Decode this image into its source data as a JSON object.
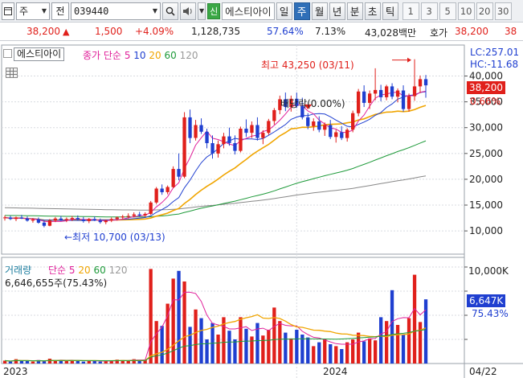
{
  "toolbar": {
    "market": "주",
    "mode": "전",
    "code": "039440",
    "badge": "신",
    "name": "에스티아이",
    "periods": [
      "일",
      "주",
      "월",
      "년",
      "분",
      "초",
      "틱"
    ],
    "active_period": "주",
    "counts": [
      "1",
      "3",
      "5",
      "10",
      "20",
      "30"
    ]
  },
  "quote": {
    "price": "38,200",
    "arrow": "▲",
    "change": "1,500",
    "pct": "+4.09%",
    "volume": "1,128,735",
    "vol_ratio": "57.64%",
    "turnover": "7.13%",
    "amount": "43,028백만",
    "ask_label": "호가",
    "ask_price": "38,200",
    "ask_price2": "38"
  },
  "panel": {
    "stock_label": "에스티아이",
    "ma_label": "종가 단순",
    "ma_periods": [
      "5",
      "10",
      "20",
      "60",
      "120"
    ],
    "high_annotation": "최고 43,250 (03/11)",
    "low_annotation": "←최저 10,700 (03/13)",
    "dividend_annotation": "배당락(0.00%)",
    "lc": "LC:257.01",
    "hc": "HC:-11.68",
    "last_price": "38,200",
    "last_pct": "0.66%",
    "vol_label": "거래량",
    "vol_ma_label": "단순",
    "vol_periods": [
      "5",
      "20",
      "60",
      "120"
    ],
    "vol_info": "6,646,655주(75.43%)",
    "vol_last": "6,647K",
    "vol_pct": "75.43%",
    "vol_max_tick": "10,000K",
    "x_labels": [
      "2023",
      "2024",
      "04/22"
    ]
  },
  "colors": {
    "up": "#e0201b",
    "down": "#1f3fd0",
    "ma5": "#e0209a",
    "ma10": "#1f3fd0",
    "ma20": "#f0a500",
    "ma60": "#1e9a3a",
    "ma120": "#888888"
  },
  "chart_data": {
    "type": "candlestick",
    "y_ticks": [
      10000,
      15000,
      20000,
      25000,
      30000,
      35000,
      40000
    ],
    "ylim": [
      5500,
      46000
    ],
    "volume_ylim": [
      0,
      10500
    ],
    "volume_ticks": [
      "10,000K"
    ],
    "last_price": 38200,
    "high": {
      "value": 43250,
      "date": "03/11"
    },
    "low": {
      "value": 10700,
      "date": "03/13"
    },
    "candles": [
      [
        12500,
        13000,
        12000,
        12600
      ],
      [
        12600,
        12900,
        12100,
        12300
      ],
      [
        12300,
        12800,
        11900,
        12600
      ],
      [
        12600,
        13100,
        12300,
        12400
      ],
      [
        12400,
        12800,
        11800,
        12000
      ],
      [
        12000,
        12500,
        11600,
        12200
      ],
      [
        12200,
        12600,
        11400,
        11600
      ],
      [
        11600,
        12000,
        10700,
        11000
      ],
      [
        11000,
        12300,
        10900,
        12000
      ],
      [
        12000,
        12700,
        11700,
        12400
      ],
      [
        12400,
        12900,
        11900,
        12100
      ],
      [
        12100,
        12600,
        11700,
        12300
      ],
      [
        12300,
        12900,
        11900,
        12500
      ],
      [
        12500,
        13000,
        12000,
        12200
      ],
      [
        12200,
        12700,
        11600,
        11900
      ],
      [
        11900,
        12500,
        11500,
        12300
      ],
      [
        12300,
        12800,
        11900,
        12000
      ],
      [
        12000,
        12400,
        11400,
        11700
      ],
      [
        11700,
        12200,
        11300,
        12000
      ],
      [
        12000,
        12600,
        11700,
        12300
      ],
      [
        12300,
        12800,
        12000,
        12600
      ],
      [
        12600,
        13100,
        12300,
        12800
      ],
      [
        12800,
        13400,
        12400,
        12900
      ],
      [
        12900,
        13600,
        12600,
        13200
      ],
      [
        13200,
        13700,
        12800,
        13000
      ],
      [
        13000,
        13600,
        12700,
        13300
      ],
      [
        13300,
        15800,
        13100,
        15500
      ],
      [
        15500,
        18500,
        15200,
        18200
      ],
      [
        18200,
        19000,
        17000,
        17500
      ],
      [
        17500,
        18800,
        17100,
        18500
      ],
      [
        18500,
        22500,
        18300,
        22000
      ],
      [
        22000,
        25000,
        19800,
        20500
      ],
      [
        20500,
        33000,
        20200,
        32000
      ],
      [
        32000,
        33500,
        27000,
        28000
      ],
      [
        28000,
        31500,
        27500,
        30500
      ],
      [
        30500,
        31800,
        28800,
        29200
      ],
      [
        29200,
        29800,
        26000,
        27000
      ],
      [
        27000,
        28500,
        24000,
        25000
      ],
      [
        25000,
        27500,
        24200,
        26800
      ],
      [
        26800,
        29000,
        26000,
        28300
      ],
      [
        28300,
        30000,
        26500,
        27000
      ],
      [
        27000,
        28500,
        24800,
        25500
      ],
      [
        25500,
        30200,
        25200,
        29800
      ],
      [
        29800,
        31600,
        28200,
        29000
      ],
      [
        29000,
        31200,
        28000,
        30500
      ],
      [
        30500,
        32000,
        27500,
        28000
      ],
      [
        28000,
        29500,
        26800,
        29000
      ],
      [
        29000,
        31700,
        28600,
        31300
      ],
      [
        31300,
        33800,
        30600,
        33400
      ],
      [
        33400,
        36200,
        32600,
        35500
      ],
      [
        35500,
        36800,
        33200,
        34000
      ],
      [
        34000,
        36200,
        33100,
        35600
      ],
      [
        35600,
        36800,
        33800,
        34200
      ],
      [
        34200,
        35800,
        31600,
        32000
      ],
      [
        32000,
        32800,
        29700,
        30300
      ],
      [
        30300,
        31800,
        29400,
        31200
      ],
      [
        31200,
        32200,
        29100,
        29600
      ],
      [
        29600,
        31000,
        28400,
        30500
      ],
      [
        30500,
        31500,
        27800,
        28200
      ],
      [
        28200,
        29600,
        27100,
        29100
      ],
      [
        29100,
        30300,
        27600,
        28000
      ],
      [
        28000,
        29900,
        27300,
        29600
      ],
      [
        29600,
        33300,
        29100,
        32800
      ],
      [
        32800,
        37500,
        32200,
        37000
      ],
      [
        37000,
        38200,
        34000,
        34800
      ],
      [
        34800,
        37200,
        33600,
        36600
      ],
      [
        36600,
        41500,
        35300,
        37300
      ],
      [
        37300,
        38300,
        35100,
        35900
      ],
      [
        35900,
        38300,
        35300,
        38000
      ],
      [
        38000,
        38600,
        35500,
        36000
      ],
      [
        36000,
        37600,
        34900,
        37200
      ],
      [
        37200,
        38200,
        33100,
        33600
      ],
      [
        33600,
        36600,
        33100,
        36100
      ],
      [
        36100,
        43250,
        35200,
        38000
      ],
      [
        38000,
        40100,
        36700,
        39400
      ],
      [
        39400,
        40200,
        35800,
        38200
      ]
    ],
    "volume_k": [
      300,
      200,
      450,
      250,
      300,
      200,
      350,
      250,
      500,
      300,
      350,
      250,
      300,
      350,
      200,
      300,
      250,
      200,
      300,
      250,
      400,
      350,
      300,
      450,
      350,
      400,
      9800,
      4400,
      3900,
      6200,
      8800,
      9600,
      8500,
      3800,
      5600,
      4700,
      2500,
      4200,
      3000,
      4800,
      3400,
      2500,
      4800,
      3600,
      2800,
      4200,
      2900,
      3500,
      5800,
      4400,
      3200,
      2600,
      3500,
      3000,
      2700,
      1800,
      2200,
      2500,
      2000,
      1800,
      1500,
      2200,
      2500,
      3200,
      2300,
      2600,
      2400,
      4800,
      4400,
      7600,
      4000,
      3000,
      4700,
      9200,
      4300,
      6647
    ]
  }
}
